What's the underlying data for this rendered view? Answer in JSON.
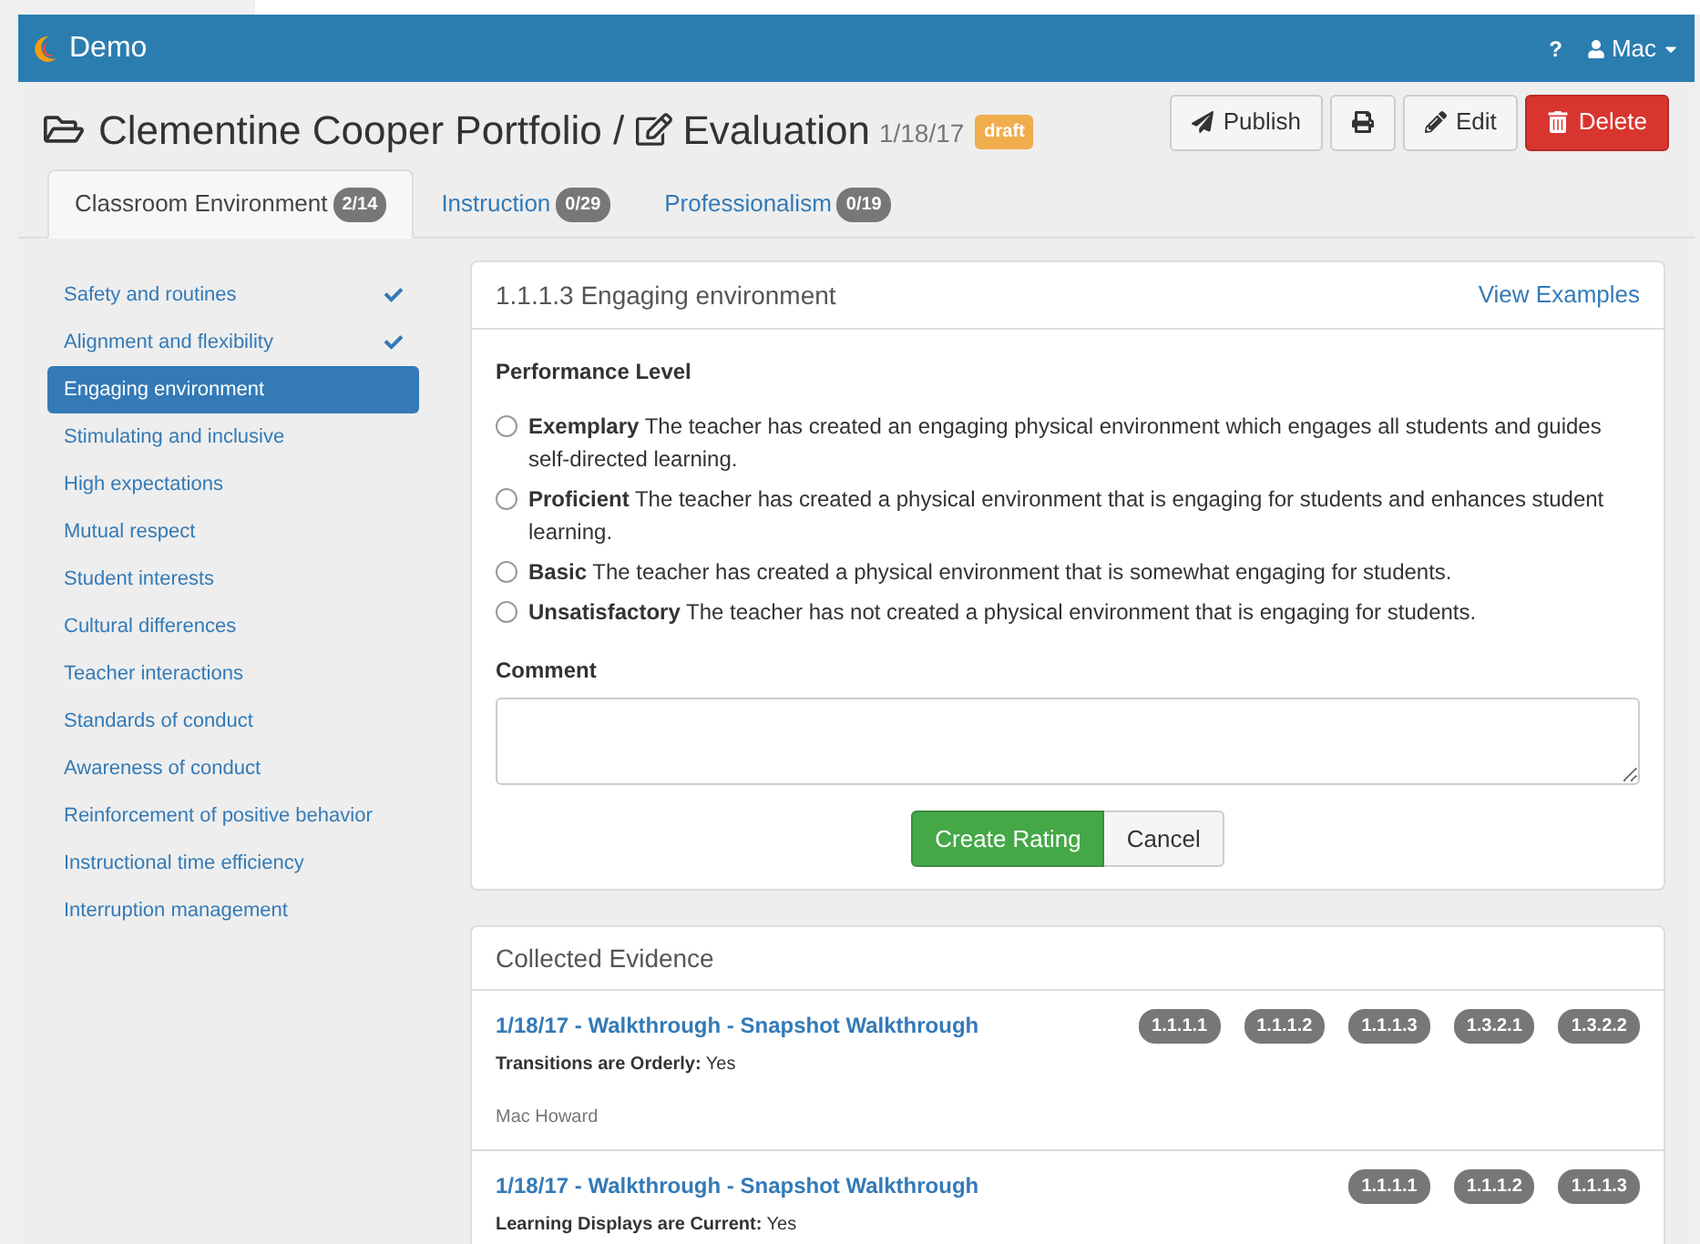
{
  "navbar": {
    "brand": "Demo",
    "help": "?",
    "user": "Mac"
  },
  "header": {
    "title": "Clementine Cooper Portfolio / ",
    "subtitle": "Evaluation",
    "date": "1/18/17",
    "badge": "draft",
    "actions": [
      {
        "kind": "publish",
        "label": "Publish"
      },
      {
        "kind": "print"
      },
      {
        "kind": "edit",
        "label": "Edit"
      },
      {
        "kind": "delete",
        "label": "Delete"
      }
    ]
  },
  "tabs": [
    {
      "label": "Classroom Environment",
      "count": "2/14",
      "selected": true
    },
    {
      "label": "Instruction",
      "count": "0/29",
      "selected": false
    },
    {
      "label": "Professionalism",
      "count": "0/19",
      "selected": false
    }
  ],
  "sidebar": {
    "items": [
      {
        "label": "Safety and routines",
        "done": true,
        "selected": false
      },
      {
        "label": "Alignment and flexibility",
        "done": true,
        "selected": false
      },
      {
        "label": "Engaging environment",
        "done": false,
        "selected": true
      },
      {
        "label": "Stimulating and inclusive",
        "done": false,
        "selected": false
      },
      {
        "label": "High expectations",
        "done": false,
        "selected": false
      },
      {
        "label": "Mutual respect",
        "done": false,
        "selected": false
      },
      {
        "label": "Student interests",
        "done": false,
        "selected": false
      },
      {
        "label": "Cultural differences",
        "done": false,
        "selected": false
      },
      {
        "label": "Teacher interactions",
        "done": false,
        "selected": false
      },
      {
        "label": "Standards of conduct",
        "done": false,
        "selected": false
      },
      {
        "label": "Awareness of conduct",
        "done": false,
        "selected": false
      },
      {
        "label": "Reinforcement of positive behavior",
        "done": false,
        "selected": false
      },
      {
        "label": "Instructional time efficiency",
        "done": false,
        "selected": false
      },
      {
        "label": "Interruption management",
        "done": false,
        "selected": false
      }
    ]
  },
  "rating_panel": {
    "title": "1.1.1.3 Engaging environment",
    "link": "View Examples",
    "level_label": "Performance Level",
    "options": [
      {
        "text": "**Exemplary** The teacher has created an engaging physical environment which engages all students and guides self-directed learning.",
        "selected": false
      },
      {
        "text": "**Proficient** The teacher has created a physical environment that is engaging for students and enhances student learning.",
        "selected": false
      },
      {
        "text": "**Basic** The teacher has created a physical environment that is somewhat engaging for students.",
        "selected": false
      },
      {
        "text": "**Unsatisfactory** The teacher has not created a physical environment that is engaging for students.",
        "selected": false
      }
    ],
    "comment_label": "Comment",
    "submit": "Create Rating",
    "cancel": "Cancel"
  },
  "evidence_panel": {
    "title": "Collected Evidence",
    "items": [
      {
        "title": "1/18/17 - Walkthrough - Snapshot Walkthrough",
        "detail": "**Transitions are Orderly:** Yes",
        "author": "Mac Howard",
        "tags": [
          "1.1.1.1",
          "1.1.1.2",
          "1.1.1.3",
          "1.3.2.1",
          "1.3.2.2"
        ]
      },
      {
        "title": "1/18/17 - Walkthrough - Snapshot Walkthrough",
        "detail": "**Learning Displays are Current:** Yes",
        "tags": [
          "1.1.1.1",
          "1.1.1.2",
          "1.1.1.3"
        ]
      }
    ]
  }
}
